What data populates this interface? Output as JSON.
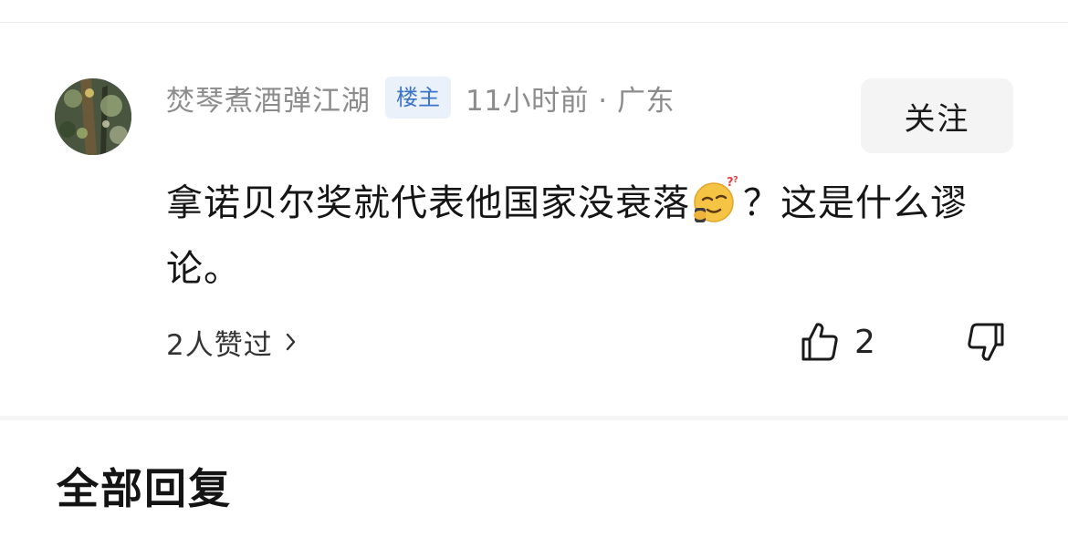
{
  "comment": {
    "username": "焚琴煮酒弹江湖",
    "op_badge": "楼主",
    "time_location": "11小时前 · 广东",
    "follow_label": "关注",
    "text_before_emoji": "拿诺贝尔奖就代表他国家没衰落",
    "emoji": "sleepy-dizzy-face-emoji",
    "text_after_emoji": "？这是什么谬论。",
    "likers_label": "2人赞过",
    "like_count": "2"
  },
  "replies": {
    "heading": "全部回复"
  },
  "colors": {
    "meta_gray": "#8c8c8c",
    "badge_blue": "#3b74c9",
    "badge_bg": "#eaf1fb",
    "follow_bg": "#f4f4f4"
  }
}
